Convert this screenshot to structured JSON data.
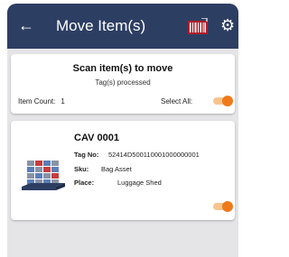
{
  "appbar": {
    "back_glyph": "←",
    "title": "Move Item(s)",
    "settings_glyph": "⚙"
  },
  "scan_card": {
    "title": "Scan item(s) to move",
    "subtitle": "Tag(s) processed",
    "count_label": "Item Count:",
    "count_value": "1",
    "select_all_label": "Select All:",
    "select_all_on": true
  },
  "items": [
    {
      "name": "CAV 0001",
      "tag_label": "Tag No:",
      "tag_value": "52414D500110001000000001",
      "sku_label": "Sku:",
      "sku_value": "Bag Asset",
      "place_label": "Place:",
      "place_value": "Luggage Shed",
      "selected": true
    }
  ],
  "colors": {
    "appbar": "#2d3e63",
    "accent": "#f07a1a",
    "background": "#e5e5e8"
  },
  "icons": [
    "back-arrow-icon",
    "barcode-scanner-icon",
    "gear-icon",
    "pallet-icon"
  ]
}
